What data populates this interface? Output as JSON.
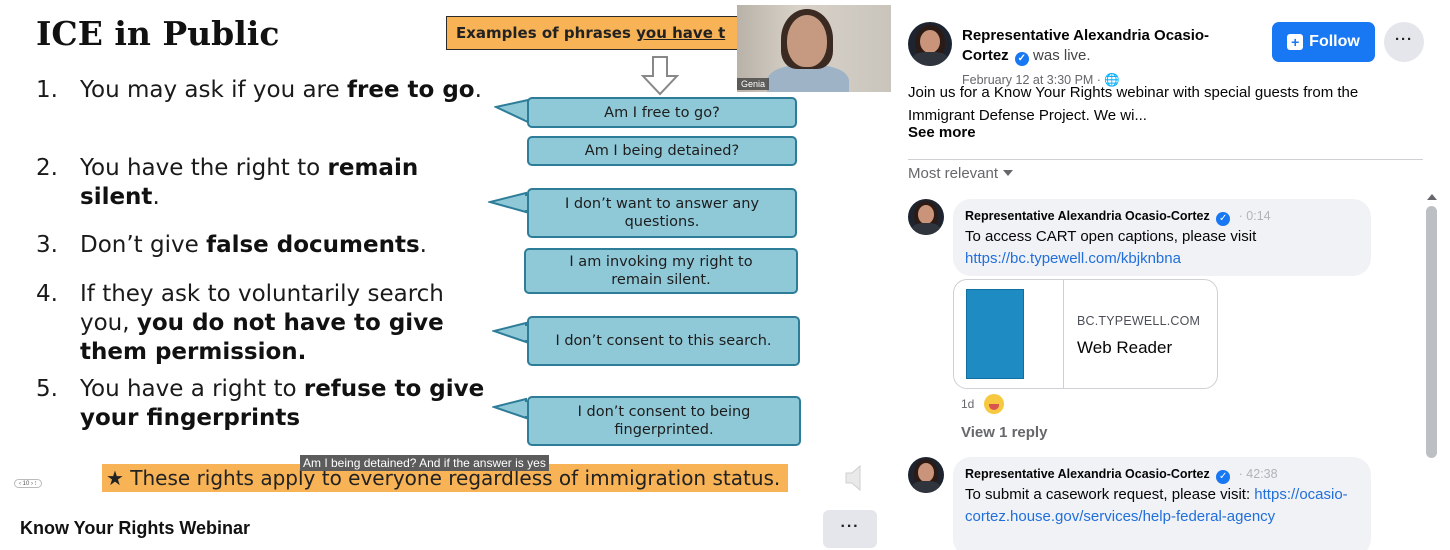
{
  "video": {
    "slide_title": "ICE in Public",
    "rights": [
      {
        "num": "1.",
        "parts": [
          {
            "t": "You may ask if you are "
          },
          {
            "t": "free to go",
            "b": true
          },
          {
            "t": "."
          }
        ]
      },
      {
        "num": "2.",
        "parts": [
          {
            "t": "You have the right to "
          },
          {
            "t": "remain silent",
            "b": true
          },
          {
            "t": "."
          }
        ]
      },
      {
        "num": "3.",
        "parts": [
          {
            "t": "Don’t give "
          },
          {
            "t": "false documents",
            "b": true
          },
          {
            "t": "."
          }
        ]
      },
      {
        "num": "4.",
        "parts": [
          {
            "t": "If they ask to voluntarily search you, "
          },
          {
            "t": "you do not have to give them permission.",
            "b": true
          }
        ]
      },
      {
        "num": "5.",
        "parts": [
          {
            "t": "You have a right to "
          },
          {
            "t": "refuse to give your fingerprints",
            "b": true
          }
        ]
      }
    ],
    "examples_banner_pre": "Examples of phrases ",
    "examples_banner_underlined": "you have t",
    "phrases": [
      "Am I free to go?",
      "Am I being detained?",
      "I don’t want to answer any questions.",
      "I am invoking my right to remain silent.",
      "I don’t consent to this search.",
      "I don’t consent to being fingerprinted."
    ],
    "star_line": "★  These rights apply to everyone regardless of immigration status.",
    "caption": "Am I being detained? And if the answer is yes",
    "webcam_name": "Genia",
    "pager_text": "‹  10  ›  ⁝",
    "title": "Know Your Rights Webinar",
    "more_label": "···"
  },
  "post": {
    "poster_name": "Representative Alexandria Ocasio-Cortez",
    "was_live": "was live.",
    "date": "February 12 at 3:30 PM · 🌐",
    "follow_label": "Follow",
    "more_label": "···",
    "description": "Join us for a Know Your Rights webinar with special guests from the Immigrant Defense Project. We wi...",
    "see_more": "See more",
    "sort_label": "Most relevant"
  },
  "comments": [
    {
      "author": "Representative Alexandria Ocasio-Cortez",
      "time": "· 0:14",
      "text": "To access CART open captions, please visit ",
      "link": "https://bc.typewell.com/kbjknbna",
      "card_domain": "BC.TYPEWELL.COM",
      "card_title": "Web Reader",
      "age": "1d",
      "view_reply": "View 1 reply"
    },
    {
      "author": "Representative Alexandria Ocasio-Cortez",
      "time": "· 42:38",
      "text": "To submit a casework request, please visit: ",
      "link": "https://ocasio-cortez.house.gov/services/help-federal-agency"
    }
  ]
}
